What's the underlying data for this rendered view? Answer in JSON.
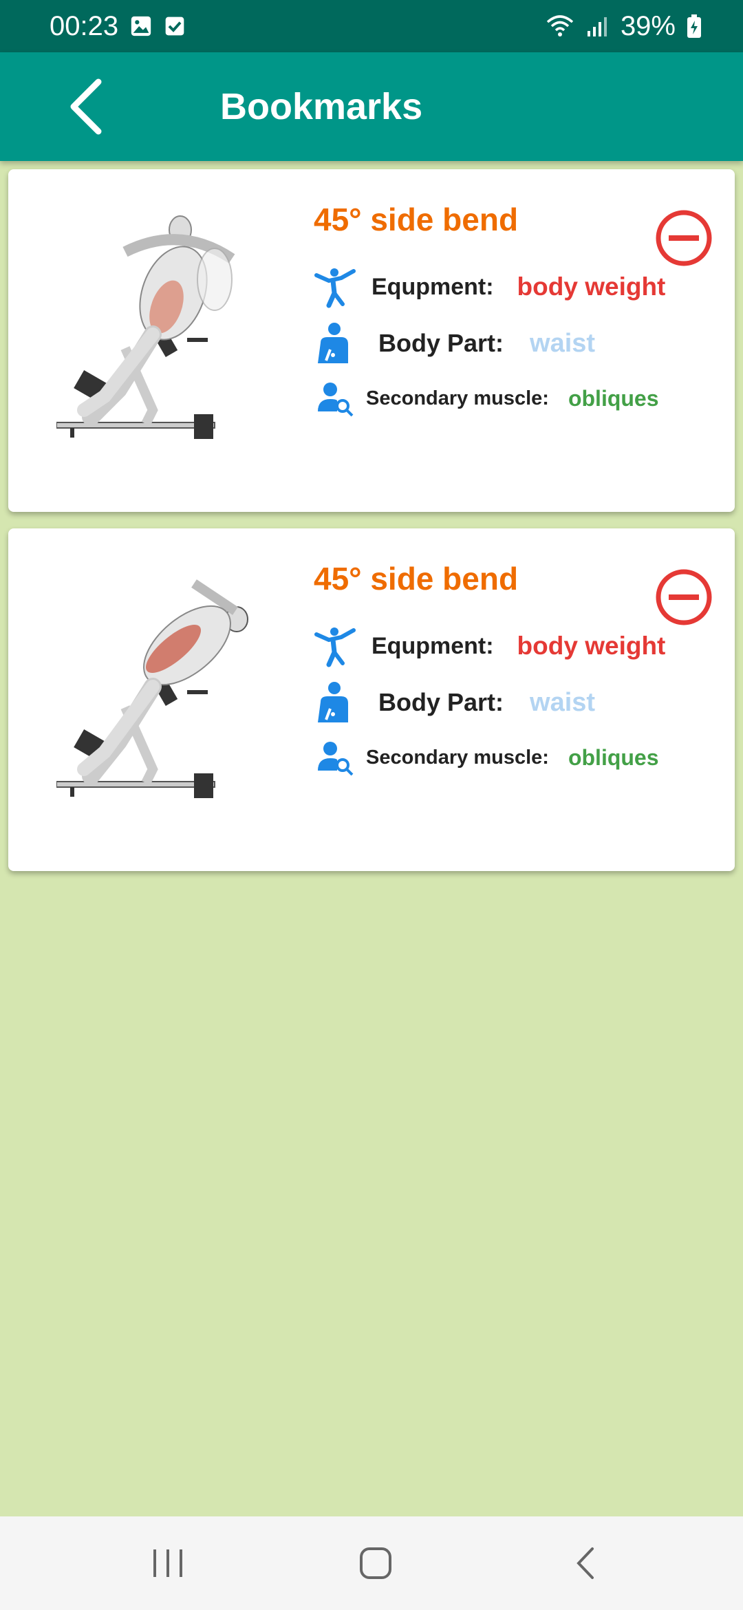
{
  "status_bar": {
    "time": "00:23",
    "battery": "39%",
    "icons": [
      "gallery-icon",
      "check-box-icon",
      "wifi-icon",
      "signal-icon",
      "battery-charging-icon"
    ]
  },
  "app_bar": {
    "title": "Bookmarks",
    "back_icon": "chevron-left-icon"
  },
  "bookmarks": [
    {
      "title": "45° side bend",
      "equipment_label": "Equpment:",
      "equipment": "body weight",
      "body_part_label": "Body Part:",
      "body_part": "waist",
      "secondary_label": "Secondary muscle:",
      "secondary": "obliques"
    },
    {
      "title": "45° side bend",
      "equipment_label": "Equpment:",
      "equipment": "body weight",
      "body_part_label": "Body Part:",
      "body_part": "waist",
      "secondary_label": "Secondary muscle:",
      "secondary": "obliques"
    }
  ],
  "colors": {
    "status_bar": "#00695c",
    "app_bar": "#009688",
    "background": "#d5e6b0",
    "title": "#ef6c00",
    "equipment": "#e53935",
    "body_part": "#b3d4f2",
    "secondary": "#43a047",
    "icon_blue": "#1e88e5",
    "remove": "#e53935"
  }
}
